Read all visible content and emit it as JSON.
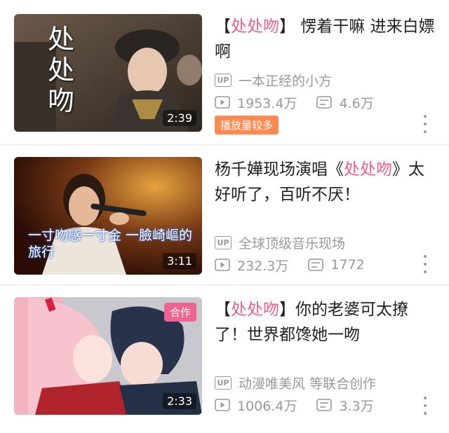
{
  "colors": {
    "accent": "#f25d8e",
    "meta": "#999999",
    "hot_badge": "#ff8a50"
  },
  "videos": [
    {
      "title_prefix": "【",
      "title_highlight": "处处吻",
      "title_rest": "】 愣着干嘛 进来白嫖啊",
      "thumb_text": "处处吻",
      "duration": "2:39",
      "uploader_icon": "up-icon",
      "uploader": "一本正经的小方",
      "plays": "1953.4万",
      "danmaku": "4.6万",
      "badge": "播放量较多"
    },
    {
      "title_prefix": "杨千嬅现场演唱《",
      "title_highlight": "处处吻",
      "title_rest": "》太好听了，百听不厌！",
      "thumb_text": "一寸吻感一寸金 一臉崎嶇的旅行",
      "duration": "3:11",
      "uploader_icon": "up-icon",
      "uploader": "全球顶级音乐现场",
      "plays": "232.3万",
      "danmaku": "1772"
    },
    {
      "title_prefix": "【",
      "title_highlight": "处处吻",
      "title_rest": "】你的老婆可太撩了！世界都馋她一吻",
      "tag": "合作",
      "duration": "2:33",
      "uploader_icon": "up-icon",
      "uploader": "动漫唯美风 等联合创作",
      "plays": "1006.4万",
      "danmaku": "3.3万"
    }
  ]
}
